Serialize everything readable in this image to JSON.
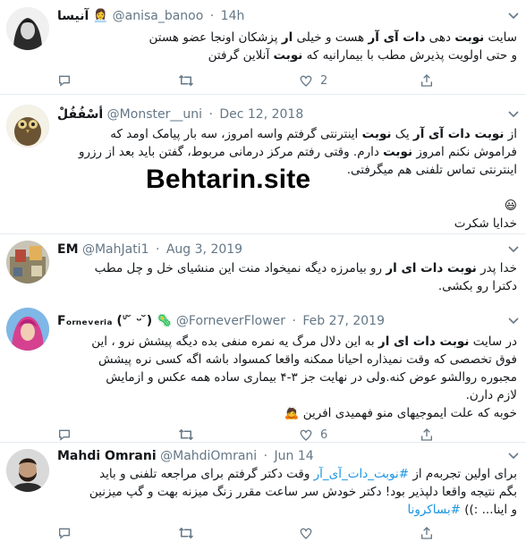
{
  "watermark": "Behtarin.site",
  "tweets": [
    {
      "name": "آنیسا",
      "emoji": "👩‍💼",
      "handle": "@anisa_banoo",
      "dot": "·",
      "time": "14h",
      "body": [
        {
          "t": "سایت "
        },
        {
          "t": "نوبت",
          "b": true
        },
        {
          "t": " دهی "
        },
        {
          "t": "دات آی آر",
          "b": true
        },
        {
          "t": " هست و خیلی "
        },
        {
          "t": "ار",
          "b": true
        },
        {
          "t": " پزشکان اونجا عضو هستن"
        },
        {
          "br": true
        },
        {
          "t": "و حتی اولویت پذیرش مطب با بیمارانیه که "
        },
        {
          "t": "نوبت",
          "b": true
        },
        {
          "t": " آنلاین گرفتن"
        }
      ],
      "reply_count": "",
      "retweet_count": "",
      "like_count": "2"
    },
    {
      "name": "أسْفُفُلْ",
      "handle": "@Monster__uni",
      "dot": "·",
      "time": "Dec 12, 2018",
      "body": [
        {
          "t": "از "
        },
        {
          "t": "نوبت دات آی آر",
          "b": true
        },
        {
          "t": " یک "
        },
        {
          "t": "نوبت",
          "b": true
        },
        {
          "t": " اینترنتی گرفتم واسه امروز، سه بار پیامک اومد که"
        },
        {
          "br": true
        },
        {
          "t": "فراموش نکنم امروز "
        },
        {
          "t": "نوبت",
          "b": true
        },
        {
          "t": " دارم. وقتی رفتم مرکز درمانی مربوط، گفتن باید بعد از رزرو"
        },
        {
          "br": true
        },
        {
          "t": "اینترنتی تماس تلفنی هم میگرفتی."
        },
        {
          "br": true
        },
        {
          "br": true
        },
        {
          "t": "😃"
        },
        {
          "br": true
        },
        {
          "t": "خدایا شکرت"
        }
      ],
      "reply_count": "",
      "retweet_count": "",
      "like_count": ""
    },
    {
      "name": "EM",
      "handle": "@MahJati1",
      "dot": "·",
      "time": "Aug 3, 2019",
      "body": [
        {
          "t": "خدا پدر "
        },
        {
          "t": "نوبت دات ای ار",
          "b": true
        },
        {
          "t": " رو بیامرزه دیگه نمیخواد منت این منشیای خل و چل مطب"
        },
        {
          "br": true
        },
        {
          "t": "دکترا رو بکشی."
        }
      ],
      "reply_count": "",
      "retweet_count": "",
      "like_count": ""
    },
    {
      "name": "Fₒᵣₙₑᵥₑᵣᵢₐ (ᐡ ̆ ᵕ ̆) 🦠",
      "handle": "@ForneverFlower",
      "dot": "·",
      "time": "Feb 27, 2019",
      "body": [
        {
          "t": "در سایت "
        },
        {
          "t": "نوبت دات ای ار",
          "b": true
        },
        {
          "t": " به این دلال مرگ یه نمره منفی بده دیگه پیشش نرو ، این"
        },
        {
          "br": true
        },
        {
          "t": "فوق تخصصی که وقت نمیذاره احیانا ممکنه واقعا کمسواد باشه اگه کسی نره پیشش"
        },
        {
          "br": true
        },
        {
          "t": "مجبوره روالشو عوض کنه.ولی در نهایت جز ۳-۴ بیماری ساده همه عکس و ازمایش"
        },
        {
          "br": true
        },
        {
          "t": "لازم دارن."
        },
        {
          "br": true
        },
        {
          "t": "خوبه که علت ایموجیهای منو فهمیدی افرین 🙇"
        }
      ],
      "reply_count": "",
      "retweet_count": "",
      "like_count": "6"
    },
    {
      "name": "Mahdi Omrani",
      "handle": "@MahdiOmrani",
      "dot": "·",
      "time": "Jun 14",
      "body": [
        {
          "t": "برای اولین تجربه‌م از "
        },
        {
          "t": "#نوبت_دات_آی_آر",
          "link": true
        },
        {
          "t": " وقت دکتر گرفتم برای مراجعه تلفنی و باید"
        },
        {
          "br": true
        },
        {
          "t": "بگم نتیجه واقعا دلپذیر بود! دکتر خودش سر ساعت مقرر زنگ میزنه بهت و گپ میزنین"
        },
        {
          "br": true
        },
        {
          "t": "و اینا... :)) "
        },
        {
          "t": "#بساکرونا",
          "link": true
        }
      ],
      "reply_count": "",
      "retweet_count": "",
      "like_count": ""
    }
  ],
  "icons": {
    "reply": "reply-icon",
    "retweet": "retweet-icon",
    "like": "heart-icon",
    "share": "share-icon",
    "caret": "chevron-down-icon"
  },
  "colors": {
    "text": "#14171a",
    "muted": "#657786",
    "link": "#1b95e0",
    "divider": "#e6ecf0"
  }
}
